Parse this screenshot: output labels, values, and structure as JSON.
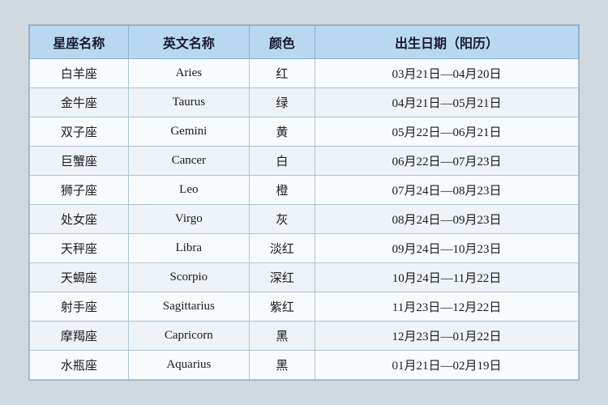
{
  "table": {
    "headers": [
      "星座名称",
      "英文名称",
      "颜色",
      "出生日期（阳历）"
    ],
    "rows": [
      {
        "chinese": "白羊座",
        "english": "Aries",
        "color": "红",
        "dates": "03月21日—04月20日"
      },
      {
        "chinese": "金牛座",
        "english": "Taurus",
        "color": "绿",
        "dates": "04月21日—05月21日"
      },
      {
        "chinese": "双子座",
        "english": "Gemini",
        "color": "黄",
        "dates": "05月22日—06月21日"
      },
      {
        "chinese": "巨蟹座",
        "english": "Cancer",
        "color": "白",
        "dates": "06月22日—07月23日"
      },
      {
        "chinese": "狮子座",
        "english": "Leo",
        "color": "橙",
        "dates": "07月24日—08月23日"
      },
      {
        "chinese": "处女座",
        "english": "Virgo",
        "color": "灰",
        "dates": "08月24日—09月23日"
      },
      {
        "chinese": "天秤座",
        "english": "Libra",
        "color": "淡红",
        "dates": "09月24日—10月23日"
      },
      {
        "chinese": "天蝎座",
        "english": "Scorpio",
        "color": "深红",
        "dates": "10月24日—11月22日"
      },
      {
        "chinese": "射手座",
        "english": "Sagittarius",
        "color": "紫红",
        "dates": "11月23日—12月22日"
      },
      {
        "chinese": "摩羯座",
        "english": "Capricorn",
        "color": "黑",
        "dates": "12月23日—01月22日"
      },
      {
        "chinese": "水瓶座",
        "english": "Aquarius",
        "color": "黑",
        "dates": "01月21日—02月19日"
      }
    ]
  }
}
